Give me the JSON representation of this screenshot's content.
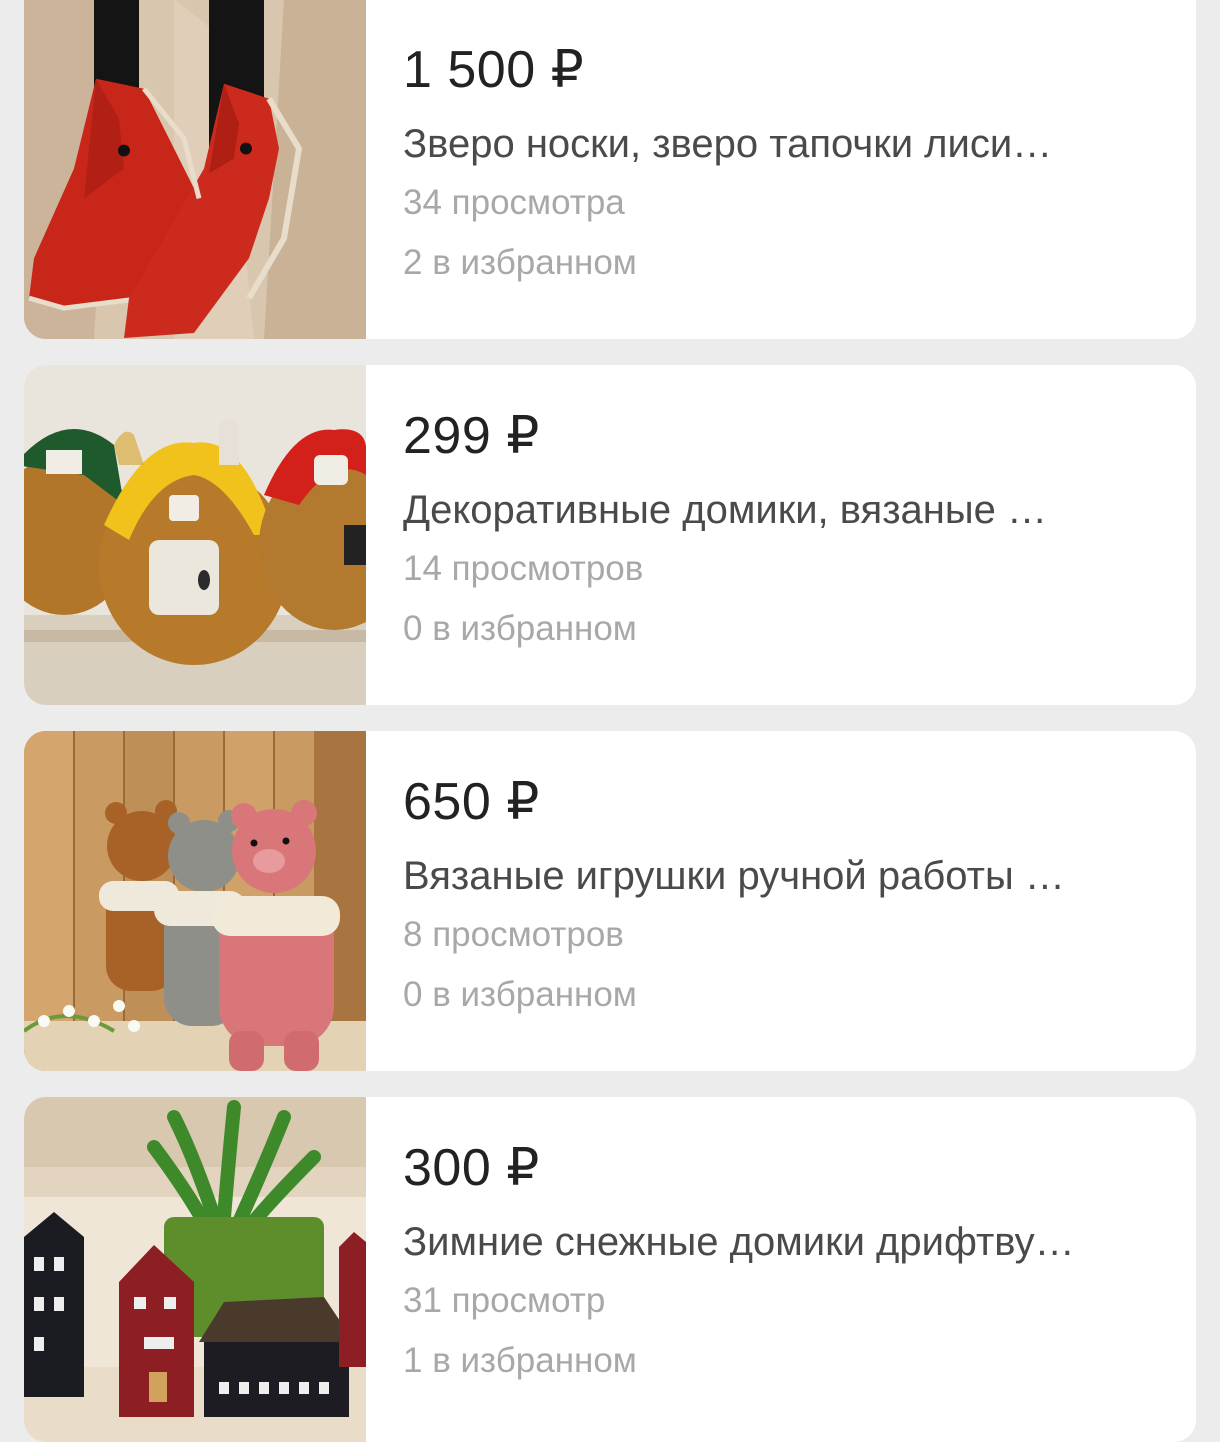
{
  "listings": [
    {
      "price": "1 500 ₽",
      "title": "Зверо носки, зверо тапочки лиси…",
      "views": "34 просмотра",
      "favorites": "2 в избранном",
      "image": "fox-slippers-photo"
    },
    {
      "price": "299 ₽",
      "title": "Декоративные домики, вязаные …",
      "views": "14 просмотров",
      "favorites": "0 в избранном",
      "image": "knitted-houses-photo"
    },
    {
      "price": "650 ₽",
      "title": "Вязаные игрушки ручной работы …",
      "views": "8 просмотров",
      "favorites": "0 в избранном",
      "image": "knitted-bears-photo"
    },
    {
      "price": "300 ₽",
      "title": "Зимние снежные домики дрифтву…",
      "views": "31 просмотр",
      "favorites": "1 в избранном",
      "image": "wooden-houses-photo"
    }
  ]
}
